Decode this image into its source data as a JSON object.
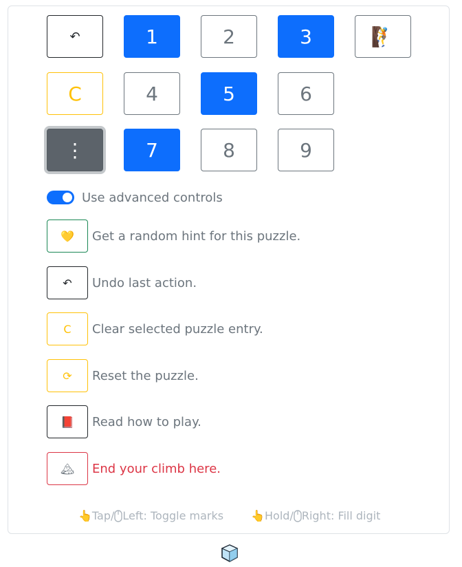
{
  "keypad": {
    "undo_glyph": "↶",
    "digits": [
      "1",
      "2",
      "3",
      "4",
      "5",
      "6",
      "7",
      "8",
      "9"
    ],
    "climber_glyph": "🧗",
    "clear_glyph": "C",
    "more_glyph": "⋮"
  },
  "toggle": {
    "label": "Use advanced controls",
    "checked": true
  },
  "actions": [
    {
      "glyph": "💛",
      "icon": "heart-hands-icon",
      "text": "Get a random hint for this puzzle."
    },
    {
      "glyph": "↶",
      "icon": "undo-icon",
      "text": "Undo last action."
    },
    {
      "glyph": "C",
      "icon": "clear-icon",
      "text": "Clear selected puzzle entry."
    },
    {
      "glyph": "⟳",
      "icon": "reset-icon",
      "text": "Reset the puzzle."
    },
    {
      "glyph": "📕",
      "icon": "book-icon",
      "text": "Read how to play."
    },
    {
      "glyph": "🏔",
      "icon": "mountain-flag-icon",
      "text": "End your climb here."
    }
  ],
  "hints": {
    "tap": "Tap/",
    "left": "Left: Toggle marks",
    "hold": "Hold/",
    "right": "Right: Fill digit"
  },
  "colors": {
    "primary": "#0d6efd",
    "warning": "#ffc107",
    "danger": "#dc3545",
    "success": "#198754",
    "dark": "#212529",
    "muted": "#6c757d"
  }
}
